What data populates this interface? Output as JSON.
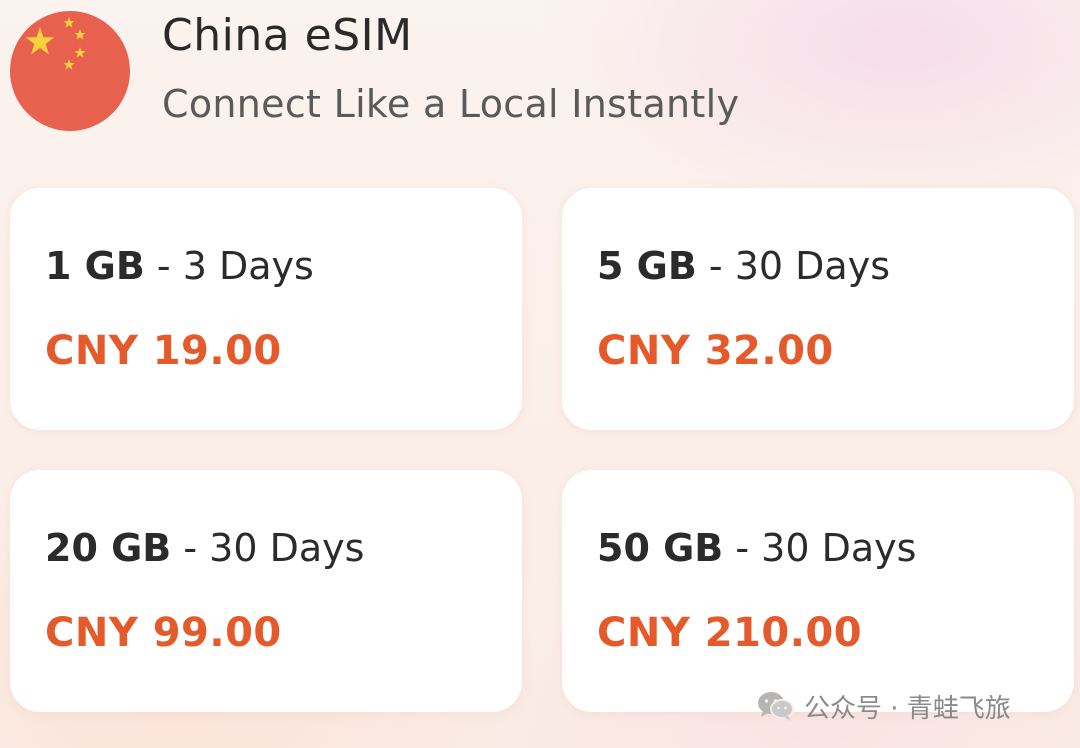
{
  "header": {
    "flag_icon": "china-flag-icon",
    "title": "China eSIM",
    "subtitle": "Connect Like a Local Instantly"
  },
  "plans": [
    {
      "data": "1 GB",
      "separator": "-",
      "duration": "3 Days",
      "price": "CNY 19.00"
    },
    {
      "data": "5 GB",
      "separator": "-",
      "duration": "30 Days",
      "price": "CNY 32.00"
    },
    {
      "data": "20 GB",
      "separator": "-",
      "duration": "30 Days",
      "price": "CNY 99.00"
    },
    {
      "data": "50 GB",
      "separator": "-",
      "duration": "30 Days",
      "price": "CNY 210.00"
    }
  ],
  "watermark": {
    "icon": "wechat-icon",
    "text": "公众号 · 青蛙飞旅"
  },
  "colors": {
    "price": "#e55a2b",
    "flag_red": "#e8614f",
    "flag_star": "#f7d23a",
    "card_bg": "#ffffff"
  }
}
